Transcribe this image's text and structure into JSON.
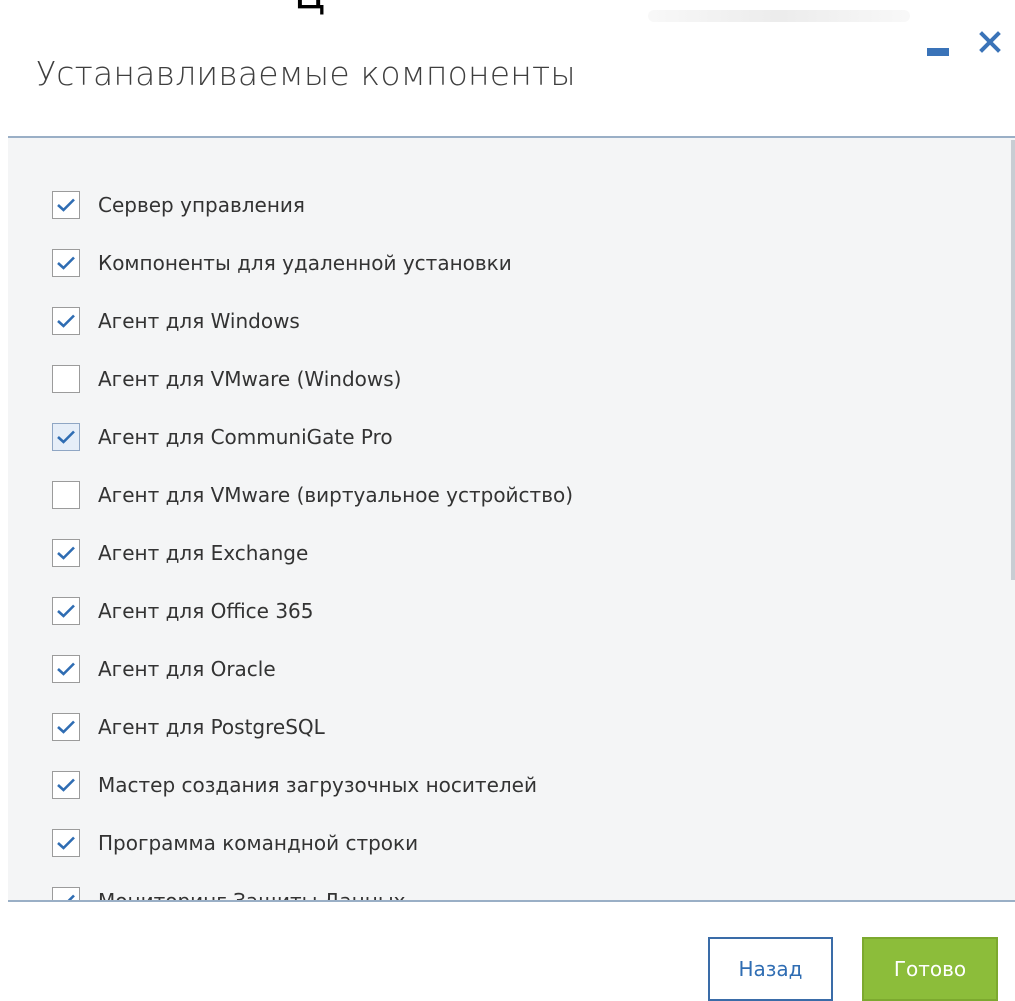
{
  "top_cut_text": "Ц",
  "window": {
    "minimize_label": "minimize",
    "close_label": "close"
  },
  "title": "Устанавливаемые компоненты",
  "components": [
    {
      "label": "Сервер управления",
      "checked": true,
      "style": "normal"
    },
    {
      "label": "Компоненты для удаленной установки",
      "checked": true,
      "style": "normal"
    },
    {
      "label": "Агент для Windows",
      "checked": true,
      "style": "normal"
    },
    {
      "label": "Агент для VMware (Windows)",
      "checked": false,
      "style": "normal"
    },
    {
      "label": "Агент для CommuniGate Pro",
      "checked": true,
      "style": "soft"
    },
    {
      "label": "Агент для VMware (виртуальное устройство)",
      "checked": false,
      "style": "normal"
    },
    {
      "label": "Агент для Exchange",
      "checked": true,
      "style": "normal"
    },
    {
      "label": "Агент для Office 365",
      "checked": true,
      "style": "normal"
    },
    {
      "label": "Агент для Oracle",
      "checked": true,
      "style": "normal"
    },
    {
      "label": "Агент для PostgreSQL",
      "checked": true,
      "style": "normal"
    },
    {
      "label": "Мастер создания загрузочных носителей",
      "checked": true,
      "style": "normal"
    },
    {
      "label": "Программа командной строки",
      "checked": true,
      "style": "normal"
    },
    {
      "label": "Мониторинг Защиты Данных",
      "checked": true,
      "style": "normal"
    }
  ],
  "buttons": {
    "back": "Назад",
    "done": "Готово"
  },
  "colors": {
    "accent_blue": "#2f6db3",
    "done_green": "#8cbd3a",
    "panel_bg": "#f4f5f6"
  }
}
